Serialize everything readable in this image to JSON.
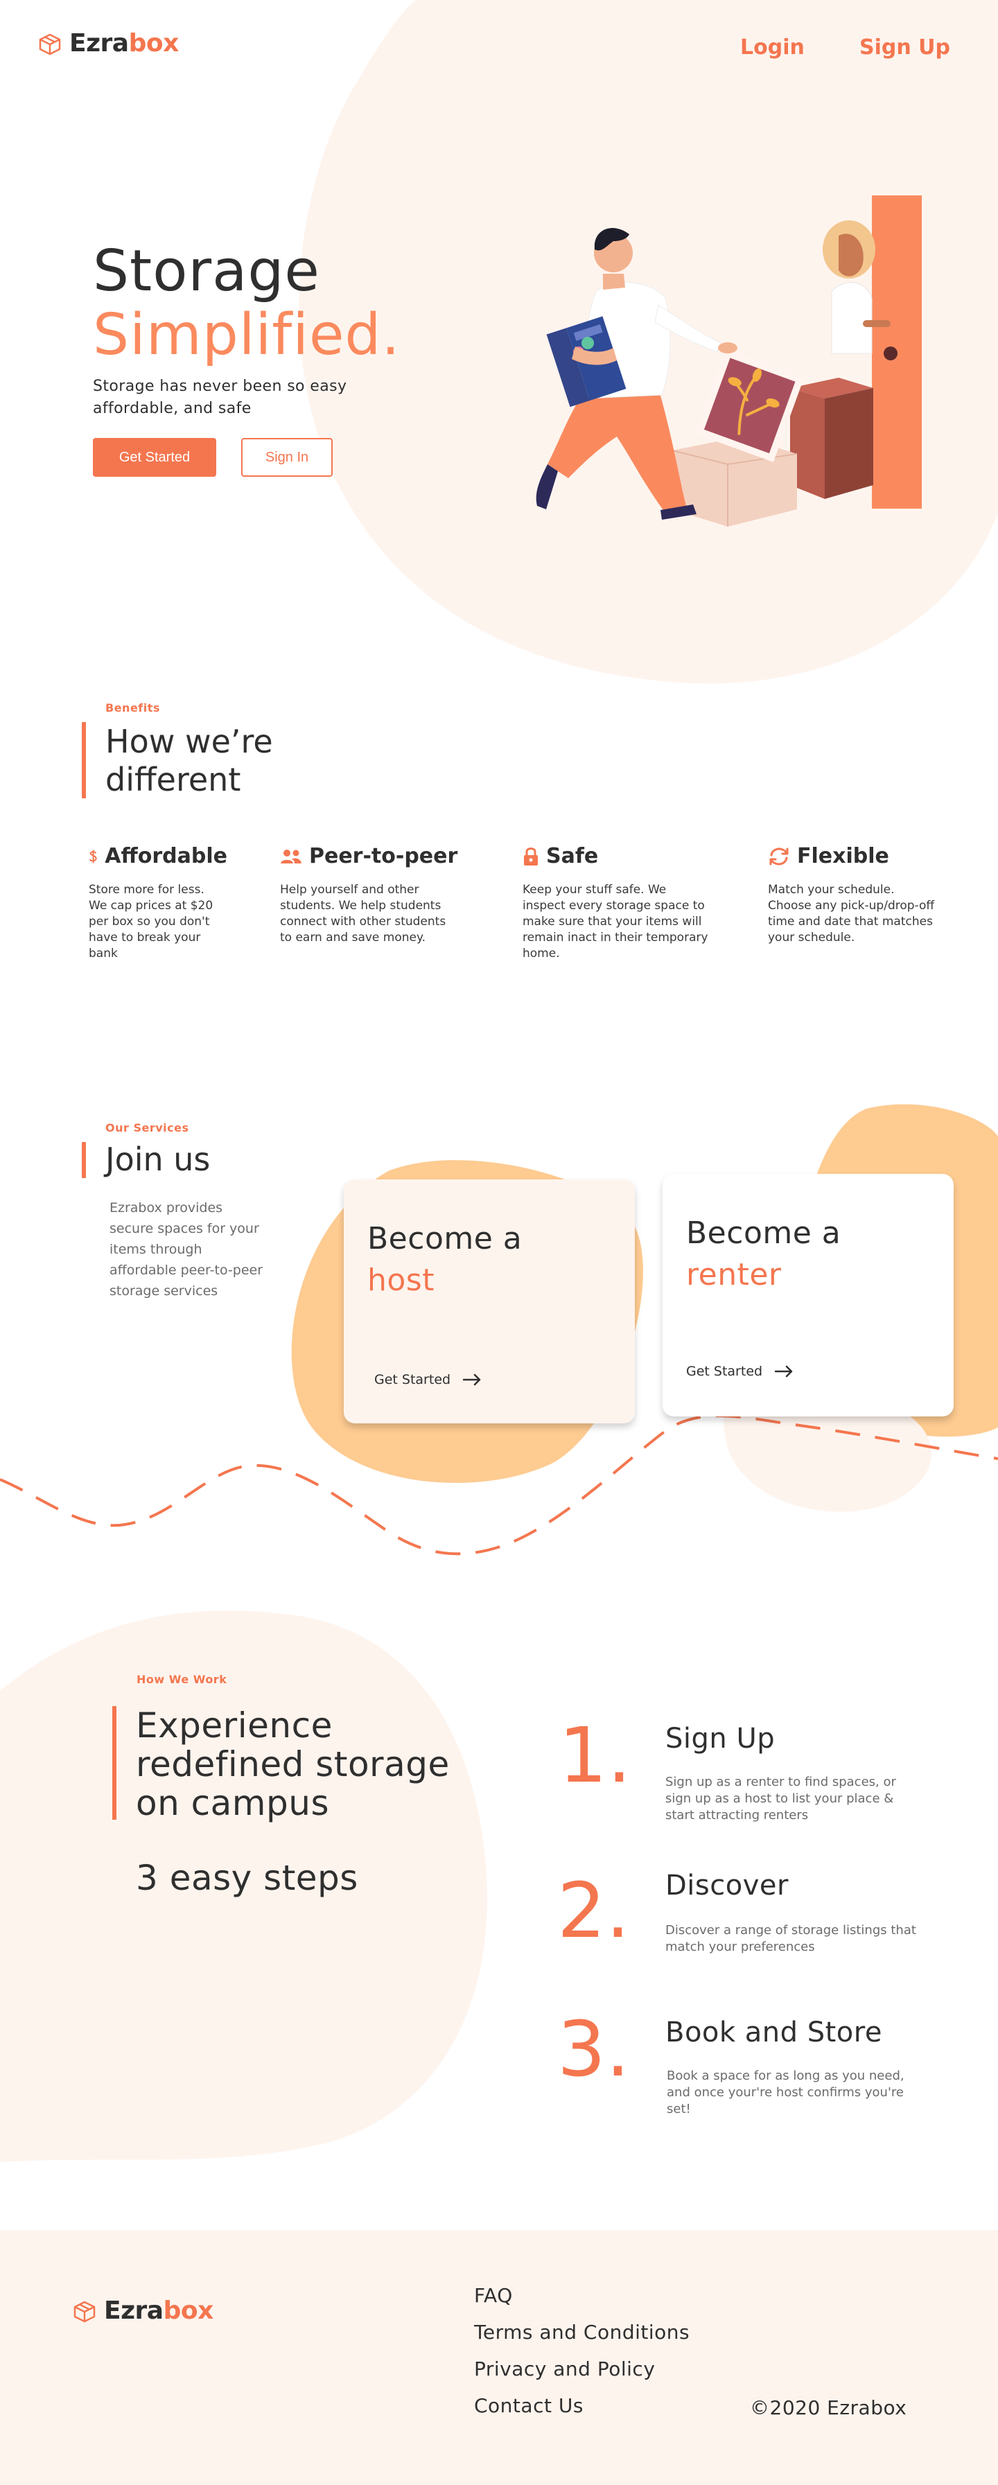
{
  "brand": {
    "name_part1": "Ezra",
    "name_part2": "box"
  },
  "header": {
    "login": "Login",
    "signup": "Sign Up"
  },
  "hero": {
    "title_line1": "Storage",
    "title_line2": "Simplified.",
    "subtitle": "Storage has never been so easy affordable, and safe",
    "primary_cta": "Get Started",
    "secondary_cta": "Sign In"
  },
  "benefits": {
    "eyebrow": "Benefits",
    "title_line1": "How we’re",
    "title_line2": "different",
    "items": [
      {
        "icon": "dollar-icon",
        "title": "Affordable",
        "text": "Store more for less. We cap prices at $20 per box so you don't have to break your bank"
      },
      {
        "icon": "people-icon",
        "title": "Peer-to-peer",
        "text": "Help yourself and other students. We help students connect with other students to earn and save money."
      },
      {
        "icon": "lock-icon",
        "title": "Safe",
        "text": "Keep your stuff safe. We inspect every storage space to make sure that your items will remain inact in their temporary home."
      },
      {
        "icon": "refresh-icon",
        "title": "Flexible",
        "text": "Match your schedule. Choose any pick-up/drop-off time and date that matches your schedule."
      }
    ]
  },
  "services": {
    "eyebrow": "Our Services",
    "title": "Join us",
    "description": "Ezrabox provides secure spaces for your items through affordable peer-to-peer storage services",
    "cards": [
      {
        "title_line1": "Become a",
        "title_line2": "host",
        "cta": "Get Started"
      },
      {
        "title_line1": "Become a",
        "title_line2": "renter",
        "cta": "Get Started"
      }
    ]
  },
  "how_we_work": {
    "eyebrow": "How We Work",
    "title_line1": "Experience",
    "title_line2": "redefined storage",
    "title_line3": "on campus",
    "subtitle": "3 easy steps",
    "steps": [
      {
        "number": "1.",
        "title": "Sign Up",
        "text": "Sign up as a renter to find spaces, or sign up as a host to list your place & start attracting renters"
      },
      {
        "number": "2.",
        "title": "Discover",
        "text": "Discover a range of storage listings that match your preferences"
      },
      {
        "number": "3.",
        "title": "Book and Store",
        "text": "Book a space for as long as you need, and once your're host confirms you're set!"
      }
    ]
  },
  "footer": {
    "links": [
      "FAQ",
      "Terms and Conditions",
      "Privacy and Policy",
      "Contact Us"
    ],
    "copyright": "©2020 Ezrabox"
  },
  "colors": {
    "accent": "#f4764f",
    "peach": "#fef4ee",
    "blob": "#fecb91"
  }
}
